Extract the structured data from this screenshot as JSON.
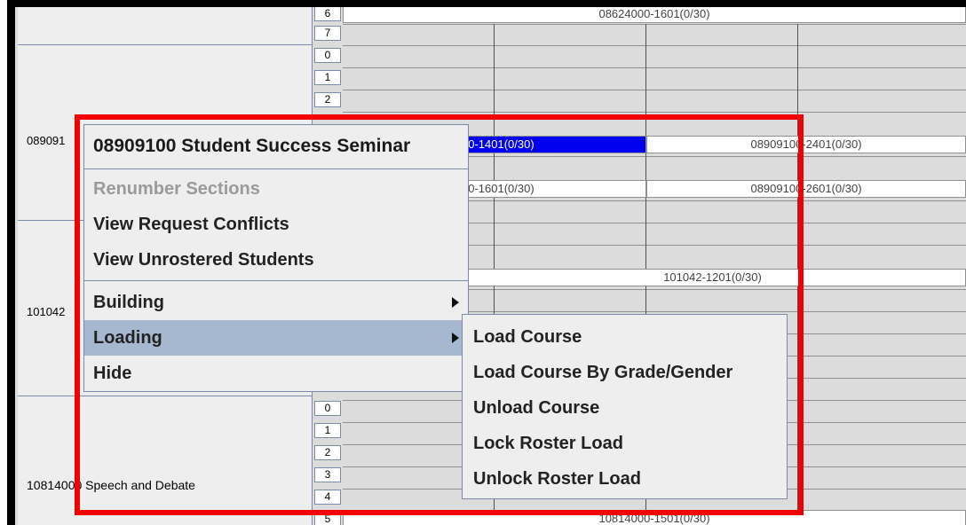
{
  "grid": {
    "courses": [
      {
        "label": ""
      },
      {
        "label": "089091"
      },
      {
        "label": "101042"
      },
      {
        "label": "10814000 Speech and Debate"
      }
    ],
    "periods": [
      "6",
      "7",
      "0",
      "1",
      "2",
      "",
      "",
      "",
      "",
      "",
      "",
      "",
      "",
      "",
      "",
      "",
      "",
      "0",
      "1",
      "2",
      "3",
      "4",
      "5"
    ],
    "cells": {
      "top_section": "08624000-1601(0/30)",
      "sel_section": "00-1401(0/30)",
      "sec_2401": "08909100-2401(0/30)",
      "sec_1601": "00-1601(0/30)",
      "sec_2601": "08909100-2601(0/30)",
      "sec_101042": "101042-1201(0/30)",
      "bottom_section": "10814000-1501(0/30)"
    }
  },
  "context_menu": {
    "title": "08909100 Student Success Seminar",
    "items": [
      {
        "label": "Renumber Sections",
        "enabled": false
      },
      {
        "label": "View Request Conflicts",
        "enabled": true
      },
      {
        "label": "View Unrostered Students",
        "enabled": true
      },
      {
        "label": "Building",
        "enabled": true,
        "submenu": true
      },
      {
        "label": "Loading",
        "enabled": true,
        "submenu": true,
        "active": true
      },
      {
        "label": "Hide",
        "enabled": true
      }
    ]
  },
  "submenu": {
    "items": [
      {
        "label": "Load Course"
      },
      {
        "label": "Load Course By Grade/Gender"
      },
      {
        "label": "Unload Course"
      },
      {
        "label": "Lock Roster Load"
      },
      {
        "label": "Unlock Roster Load"
      }
    ]
  },
  "colors": {
    "highlight": "#f20000",
    "selection": "#0000ee",
    "menu_active": "#a6b8cf"
  }
}
